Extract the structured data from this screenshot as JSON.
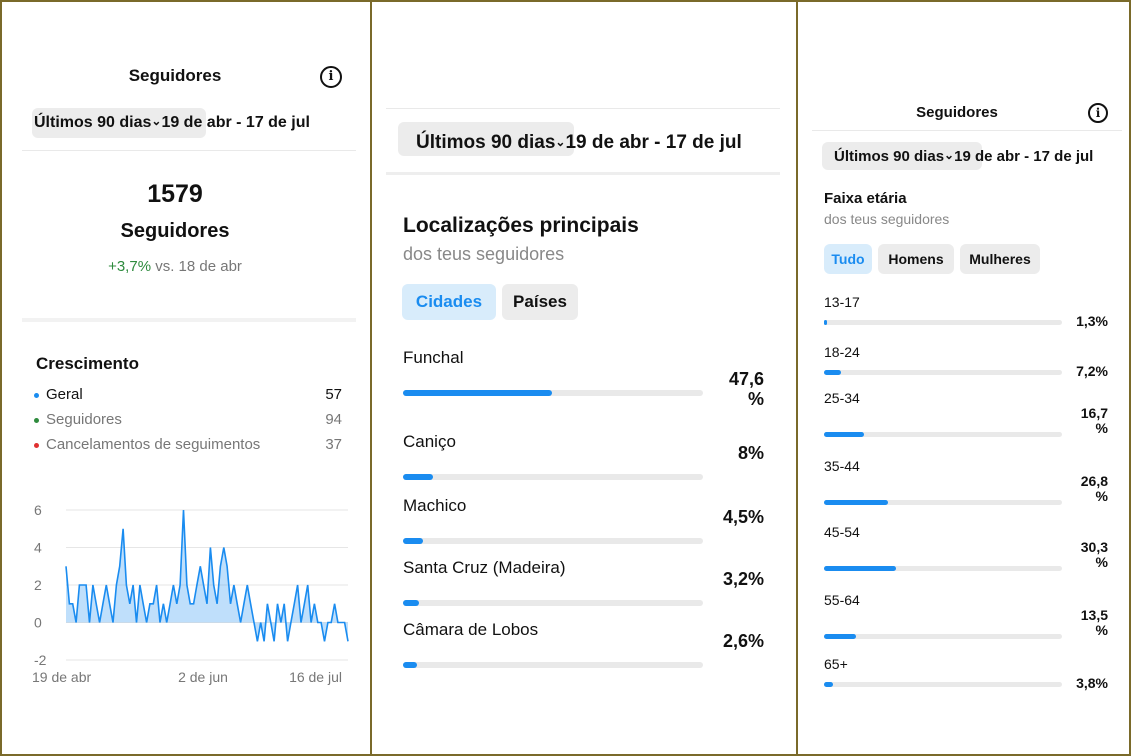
{
  "colors": {
    "accent": "#1a8cf0",
    "positive": "#2e8b3d",
    "negative": "#e03030",
    "border": "#7a6a2a"
  },
  "panel1": {
    "title": "Seguidores",
    "info_icon": "info-icon",
    "range_label": "Últimos 90 dias",
    "range_dates": "19 de abr - 17 de jul",
    "total": "1579",
    "total_label": "Seguidores",
    "change_value": "+3,7%",
    "change_suffix": "vs. 18 de abr",
    "growth_title": "Crescimento",
    "growth_items": [
      {
        "label": "Geral",
        "value": "57",
        "color": "#1a8cf0"
      },
      {
        "label": "Seguidores",
        "value": "94",
        "color": "#2e8b3d"
      },
      {
        "label": "Cancelamentos de seguimentos",
        "value": "37",
        "color": "#e03030"
      }
    ],
    "chart_data": {
      "type": "area",
      "title": "",
      "xlabel": "",
      "ylabel": "",
      "ylim": [
        -2,
        6
      ],
      "yticks": [
        "6",
        "4",
        "2",
        "0",
        "-2"
      ],
      "xticks": [
        "19 de abr",
        "2 de jun",
        "16 de jul"
      ],
      "grid": true,
      "series": [
        {
          "values": [
            3,
            1,
            1,
            0,
            2,
            2,
            2,
            0,
            2,
            1,
            0,
            1,
            2,
            1,
            0,
            2,
            3,
            5,
            2,
            1,
            2,
            0,
            2,
            1,
            0,
            1,
            1,
            2,
            0,
            1,
            0,
            1,
            2,
            1,
            2,
            6,
            2,
            1,
            1,
            2,
            3,
            2,
            1,
            4,
            2,
            1,
            3,
            4,
            3,
            1,
            2,
            1,
            0,
            1,
            2,
            1,
            0,
            -1,
            0,
            -1,
            1,
            0,
            -1,
            1,
            0,
            1,
            -1,
            0,
            1,
            2,
            0,
            1,
            2,
            0,
            1,
            0,
            0,
            -1,
            0,
            0,
            1,
            0,
            0,
            0,
            -1
          ]
        }
      ]
    }
  },
  "panel2": {
    "range_label": "Últimos 90 dias",
    "range_dates": "19 de abr - 17 de jul",
    "title": "Localizações principais",
    "subtitle": "dos teus seguidores",
    "tabs": [
      "Cidades",
      "Países"
    ],
    "locations": [
      {
        "name": "Funchal",
        "pct": "47,6 %",
        "value": 47.6
      },
      {
        "name": "Caniço",
        "pct": "8%",
        "value": 8
      },
      {
        "name": "Machico",
        "pct": "4,5%",
        "value": 4.5
      },
      {
        "name": "Santa Cruz (Madeira)",
        "pct": "3,2%",
        "value": 3.2
      },
      {
        "name": "Câmara de Lobos",
        "pct": "2,6%",
        "value": 2.6
      }
    ]
  },
  "panel3": {
    "title": "Seguidores",
    "info_icon": "info-icon",
    "range_label": "Últimos 90 dias",
    "range_dates": "19 de abr - 17 de jul",
    "section_title": "Faixa etária",
    "section_subtitle": "dos teus seguidores",
    "tabs": [
      "Tudo",
      "Homens",
      "Mulheres"
    ],
    "ages": [
      {
        "label": "13-17",
        "pct": "1,3%",
        "value": 1.3
      },
      {
        "label": "18-24",
        "pct": "7,2%",
        "value": 7.2
      },
      {
        "label": "25-34",
        "pct": "16,7 %",
        "value": 16.7
      },
      {
        "label": "35-44",
        "pct": "26,8 %",
        "value": 26.8
      },
      {
        "label": "45-54",
        "pct": "30,3 %",
        "value": 30.3
      },
      {
        "label": "55-64",
        "pct": "13,5 %",
        "value": 13.5
      },
      {
        "label": "65+",
        "pct": "3,8%",
        "value": 3.8
      }
    ]
  }
}
